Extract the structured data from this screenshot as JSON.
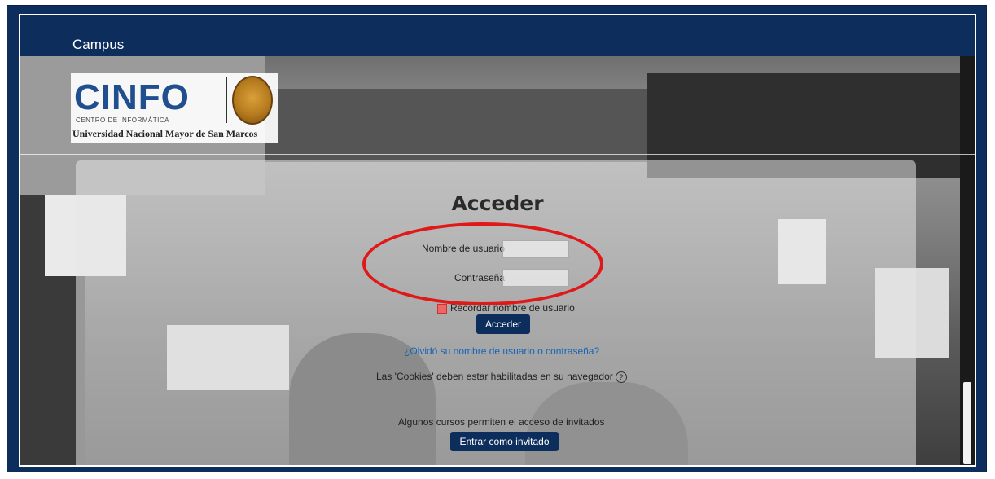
{
  "navbar": {
    "brand": "Campus"
  },
  "logo": {
    "name": "CINFO",
    "subtitle": "CENTRO DE INFORMÁTICA",
    "university": "Universidad Nacional Mayor de San Marcos"
  },
  "login": {
    "title": "Acceder",
    "username_label": "Nombre de usuario",
    "username_value": "",
    "password_label": "Contraseña",
    "password_value": "",
    "remember_label": "Recordar nombre de usuario",
    "submit_label": "Acceder",
    "forgot_link": "¿Olvidó su nombre de usuario o contraseña?",
    "cookies_text": "Las 'Cookies' deben estar habilitadas en su navegador",
    "guest_text": "Algunos cursos permiten el acceso de invitados",
    "guest_button": "Entrar como invitado"
  },
  "icons": {
    "help": "question-circle-icon",
    "seal": "university-seal-icon"
  },
  "colors": {
    "navbar": "#0d2e5c",
    "button": "#0d2e5c",
    "link": "#1466b8",
    "annotation": "#e01818"
  }
}
